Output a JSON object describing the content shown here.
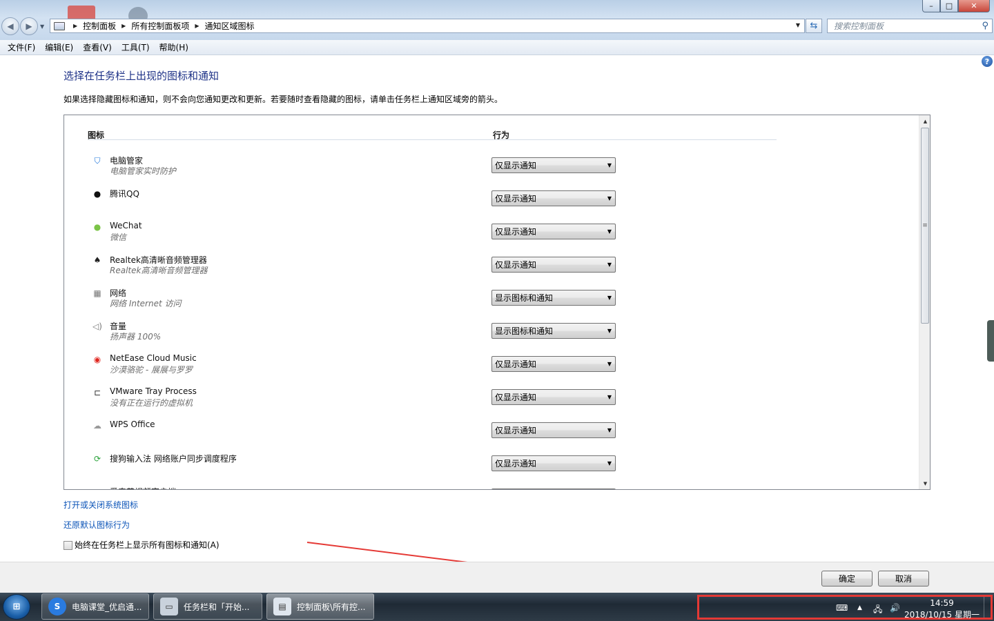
{
  "address": {
    "crumbs": [
      "控制面板",
      "所有控制面板项",
      "通知区域图标"
    ],
    "search_placeholder": "搜索控制面板"
  },
  "window_controls": {
    "minimize": "–",
    "maximize": "□",
    "close": "✕"
  },
  "menu": [
    "文件(F)",
    "编辑(E)",
    "查看(V)",
    "工具(T)",
    "帮助(H)"
  ],
  "page": {
    "title": "选择在任务栏上出现的图标和通知",
    "intro": "如果选择隐藏图标和通知，则不会向您通知更改和更新。若要随时查看隐藏的图标，请单击任务栏上通知区域旁的箭头。",
    "col_icon": "图标",
    "col_behavior": "行为",
    "rows": [
      {
        "name": "电脑管家",
        "sub": "电脑管家实时防护",
        "behavior": "仅显示通知",
        "icon": "shield-icon",
        "color": "#1a73d9"
      },
      {
        "name": "腾讯QQ",
        "sub": "",
        "behavior": "仅显示通知",
        "icon": "penguin-icon",
        "color": "#111111"
      },
      {
        "name": "WeChat",
        "sub": "微信",
        "behavior": "仅显示通知",
        "icon": "wechat-icon",
        "color": "#7bc447"
      },
      {
        "name": "Realtek高清晰音频管理器",
        "sub": "Realtek高清晰音频管理器",
        "behavior": "仅显示通知",
        "icon": "speaker-crab-icon",
        "color": "#222222"
      },
      {
        "name": "网络",
        "sub": "网络 Internet 访问",
        "behavior": "显示图标和通知",
        "icon": "network-icon",
        "color": "#777777"
      },
      {
        "name": "音量",
        "sub": "扬声器 100%",
        "behavior": "显示图标和通知",
        "icon": "volume-icon",
        "color": "#777777"
      },
      {
        "name": "NetEase Cloud Music",
        "sub": "沙漠骆驼 - 展展与罗罗",
        "behavior": "仅显示通知",
        "icon": "netease-music-icon",
        "color": "#e0261f"
      },
      {
        "name": "VMware Tray Process",
        "sub": "没有正在运行的虚拟机",
        "behavior": "仅显示通知",
        "icon": "vmware-icon",
        "color": "#333333"
      },
      {
        "name": "WPS Office",
        "sub": "",
        "behavior": "仅显示通知",
        "icon": "wps-cloud-icon",
        "color": "#999999"
      },
      {
        "name": "搜狗输入法 网络账户同步调度程序",
        "sub": "",
        "behavior": "仅显示通知",
        "icon": "sogou-sync-icon",
        "color": "#2aa23a"
      },
      {
        "name": "爱奇艺视频客户端",
        "sub": "",
        "behavior": "",
        "icon": "iqiyi-icon",
        "color": "#22a845"
      }
    ],
    "link_system_icons": "打开或关闭系统图标",
    "link_restore": "还原默认图标行为",
    "always_show_label": "始终在任务栏上显示所有图标和通知(A)"
  },
  "buttons": {
    "ok": "确定",
    "cancel": "取消"
  },
  "taskbar": {
    "items": [
      {
        "label": "电脑课堂_优启通...",
        "icon": "sogou-s-icon"
      },
      {
        "label": "任务栏和「开始...",
        "icon": "taskbar-props-icon"
      },
      {
        "label": "控制面板\\所有控...",
        "icon": "control-panel-icon"
      }
    ],
    "time": "14:59",
    "date": "2018/10/15 星期一"
  },
  "colors": {
    "accent_title": "#1e3287",
    "link": "#0d55b8",
    "highlight_box": "#e53935"
  }
}
